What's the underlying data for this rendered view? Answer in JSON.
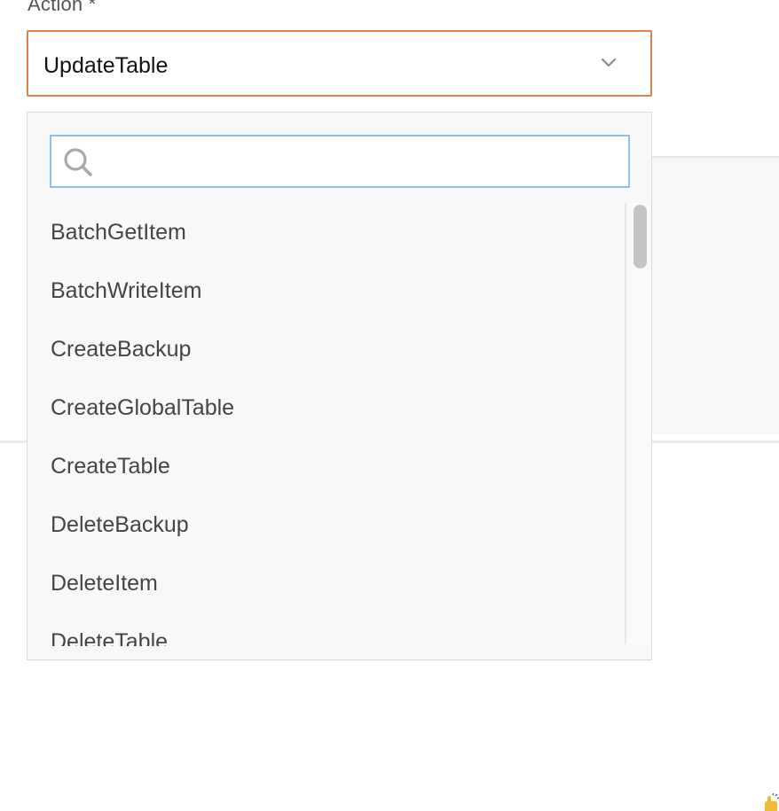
{
  "field": {
    "label": "Action *",
    "selected_value": "UpdateTable"
  },
  "search": {
    "placeholder": "",
    "value": ""
  },
  "options": [
    "BatchGetItem",
    "BatchWriteItem",
    "CreateBackup",
    "CreateGlobalTable",
    "CreateTable",
    "DeleteBackup",
    "DeleteItem",
    "DeleteTable"
  ],
  "colors": {
    "select_border": "#e0814a",
    "search_border": "#8fc0ea",
    "dropdown_bg": "#f8f8f8",
    "item_text": "#454545"
  },
  "icons": {
    "dropdown_toggle": "chevron-down-icon",
    "search": "search-icon",
    "corner": "hand-icon"
  }
}
